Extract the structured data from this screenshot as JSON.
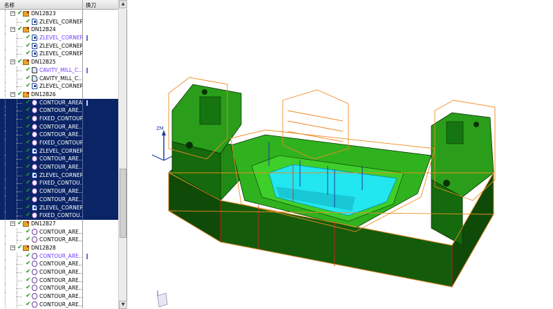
{
  "navigator": {
    "columns": {
      "name": "名称",
      "tool": "换刀"
    },
    "rows": [
      {
        "label": "DN12B23",
        "kind": "group",
        "depth": 0,
        "expanded": true,
        "selected": false,
        "tool_mark": false,
        "color": "normal"
      },
      {
        "label": "ZLEVEL_CORNER...",
        "kind": "zlevel",
        "depth": 1,
        "selected": false,
        "tool_mark": false,
        "color": "normal"
      },
      {
        "label": "DN12B24",
        "kind": "group",
        "depth": 0,
        "expanded": true,
        "selected": false,
        "tool_mark": false,
        "color": "normal"
      },
      {
        "label": "ZLEVEL_CORNER...",
        "kind": "zlevel",
        "depth": 1,
        "selected": false,
        "tool_mark": true,
        "color": "purple"
      },
      {
        "label": "ZLEVEL_CORNER...",
        "kind": "zlevel",
        "depth": 1,
        "selected": false,
        "tool_mark": false,
        "color": "normal"
      },
      {
        "label": "ZLEVEL_CORNER...",
        "kind": "zlevel",
        "depth": 1,
        "selected": false,
        "tool_mark": false,
        "color": "normal"
      },
      {
        "label": "DN12B25",
        "kind": "group",
        "depth": 0,
        "expanded": true,
        "selected": false,
        "tool_mark": false,
        "color": "normal"
      },
      {
        "label": "CAVITY_MILL_C...",
        "kind": "cavity",
        "depth": 1,
        "selected": false,
        "tool_mark": true,
        "color": "purple"
      },
      {
        "label": "CAVITY_MILL_C...",
        "kind": "cavity",
        "depth": 1,
        "selected": false,
        "tool_mark": false,
        "color": "normal"
      },
      {
        "label": "ZLEVEL_CORNER...",
        "kind": "zlevel",
        "depth": 1,
        "selected": false,
        "tool_mark": false,
        "color": "normal"
      },
      {
        "label": "DN12B26",
        "kind": "group",
        "depth": 0,
        "expanded": true,
        "selected": false,
        "tool_mark": false,
        "color": "normal"
      },
      {
        "label": "CONTOUR_AREA",
        "kind": "contour",
        "depth": 1,
        "selected": true,
        "tool_mark": true,
        "color": "normal"
      },
      {
        "label": "CONTOUR_ARE...",
        "kind": "contour",
        "depth": 1,
        "selected": true,
        "tool_mark": false,
        "color": "normal"
      },
      {
        "label": "FIXED_CONTOUR",
        "kind": "contour",
        "depth": 1,
        "selected": true,
        "tool_mark": false,
        "color": "normal"
      },
      {
        "label": "CONTOUR_ARE...",
        "kind": "contour",
        "depth": 1,
        "selected": true,
        "tool_mark": false,
        "color": "normal"
      },
      {
        "label": "CONTOUR_ARE...",
        "kind": "contour",
        "depth": 1,
        "selected": true,
        "tool_mark": false,
        "color": "normal"
      },
      {
        "label": "FIXED_CONTOUR",
        "kind": "contour",
        "depth": 1,
        "selected": true,
        "tool_mark": false,
        "color": "normal"
      },
      {
        "label": "ZLEVEL_CORNER...",
        "kind": "zlevel",
        "depth": 1,
        "selected": true,
        "tool_mark": false,
        "color": "normal"
      },
      {
        "label": "CONTOUR_ARE...",
        "kind": "contour",
        "depth": 1,
        "selected": true,
        "tool_mark": false,
        "color": "normal"
      },
      {
        "label": "CONTOUR_ARE...",
        "kind": "contour",
        "depth": 1,
        "selected": true,
        "tool_mark": false,
        "color": "normal"
      },
      {
        "label": "ZLEVEL_CORNER...",
        "kind": "zlevel",
        "depth": 1,
        "selected": true,
        "tool_mark": false,
        "color": "normal"
      },
      {
        "label": "FIXED_CONTOU...",
        "kind": "contour",
        "depth": 1,
        "selected": true,
        "tool_mark": false,
        "color": "normal"
      },
      {
        "label": "CONTOUR_ARE...",
        "kind": "contour",
        "depth": 1,
        "selected": true,
        "tool_mark": false,
        "color": "normal"
      },
      {
        "label": "CONTOUR_ARE...",
        "kind": "contour",
        "depth": 1,
        "selected": true,
        "tool_mark": false,
        "color": "normal"
      },
      {
        "label": "ZLEVEL_CORNER...",
        "kind": "zlevel",
        "depth": 1,
        "selected": true,
        "tool_mark": false,
        "color": "normal"
      },
      {
        "label": "FIXED_CONTOU...",
        "kind": "contour",
        "depth": 1,
        "selected": true,
        "tool_mark": false,
        "color": "normal"
      },
      {
        "label": "DN12B27",
        "kind": "group",
        "depth": 0,
        "expanded": true,
        "selected": false,
        "tool_mark": false,
        "color": "normal"
      },
      {
        "label": "CONTOUR_ARE...",
        "kind": "contour",
        "depth": 1,
        "selected": false,
        "tool_mark": false,
        "color": "normal"
      },
      {
        "label": "CONTOUR_ARE...",
        "kind": "contour",
        "depth": 1,
        "selected": false,
        "tool_mark": false,
        "color": "normal"
      },
      {
        "label": "DN12B28",
        "kind": "group",
        "depth": 0,
        "expanded": true,
        "selected": false,
        "tool_mark": false,
        "color": "normal"
      },
      {
        "label": "CONTOUR_ARE...",
        "kind": "contour",
        "depth": 1,
        "selected": false,
        "tool_mark": true,
        "color": "purple"
      },
      {
        "label": "CONTOUR_ARE...",
        "kind": "contour",
        "depth": 1,
        "selected": false,
        "tool_mark": false,
        "color": "normal"
      },
      {
        "label": "CONTOUR_ARE...",
        "kind": "contour",
        "depth": 1,
        "selected": false,
        "tool_mark": false,
        "color": "normal"
      },
      {
        "label": "CONTOUR_ARE...",
        "kind": "contour",
        "depth": 1,
        "selected": false,
        "tool_mark": false,
        "color": "normal"
      },
      {
        "label": "CONTOUR_ARE...",
        "kind": "contour",
        "depth": 1,
        "selected": false,
        "tool_mark": false,
        "color": "normal"
      },
      {
        "label": "CONTOUR_ARE...",
        "kind": "contour",
        "depth": 1,
        "selected": false,
        "tool_mark": false,
        "color": "normal"
      },
      {
        "label": "CONTOUR_ARE...",
        "kind": "contour",
        "depth": 1,
        "selected": false,
        "tool_mark": false,
        "color": "normal"
      }
    ]
  },
  "viewport": {
    "axis": {
      "z_label": "ZM",
      "x_label": ""
    },
    "colors": {
      "model_green": "#1f8a14",
      "model_dark": "#0f4a08",
      "cavity_cyan": "#22e6f0",
      "toolpath_orange": "#f08a22",
      "selection_red": "#e02020",
      "axis_blue": "#1a3e9a"
    }
  }
}
